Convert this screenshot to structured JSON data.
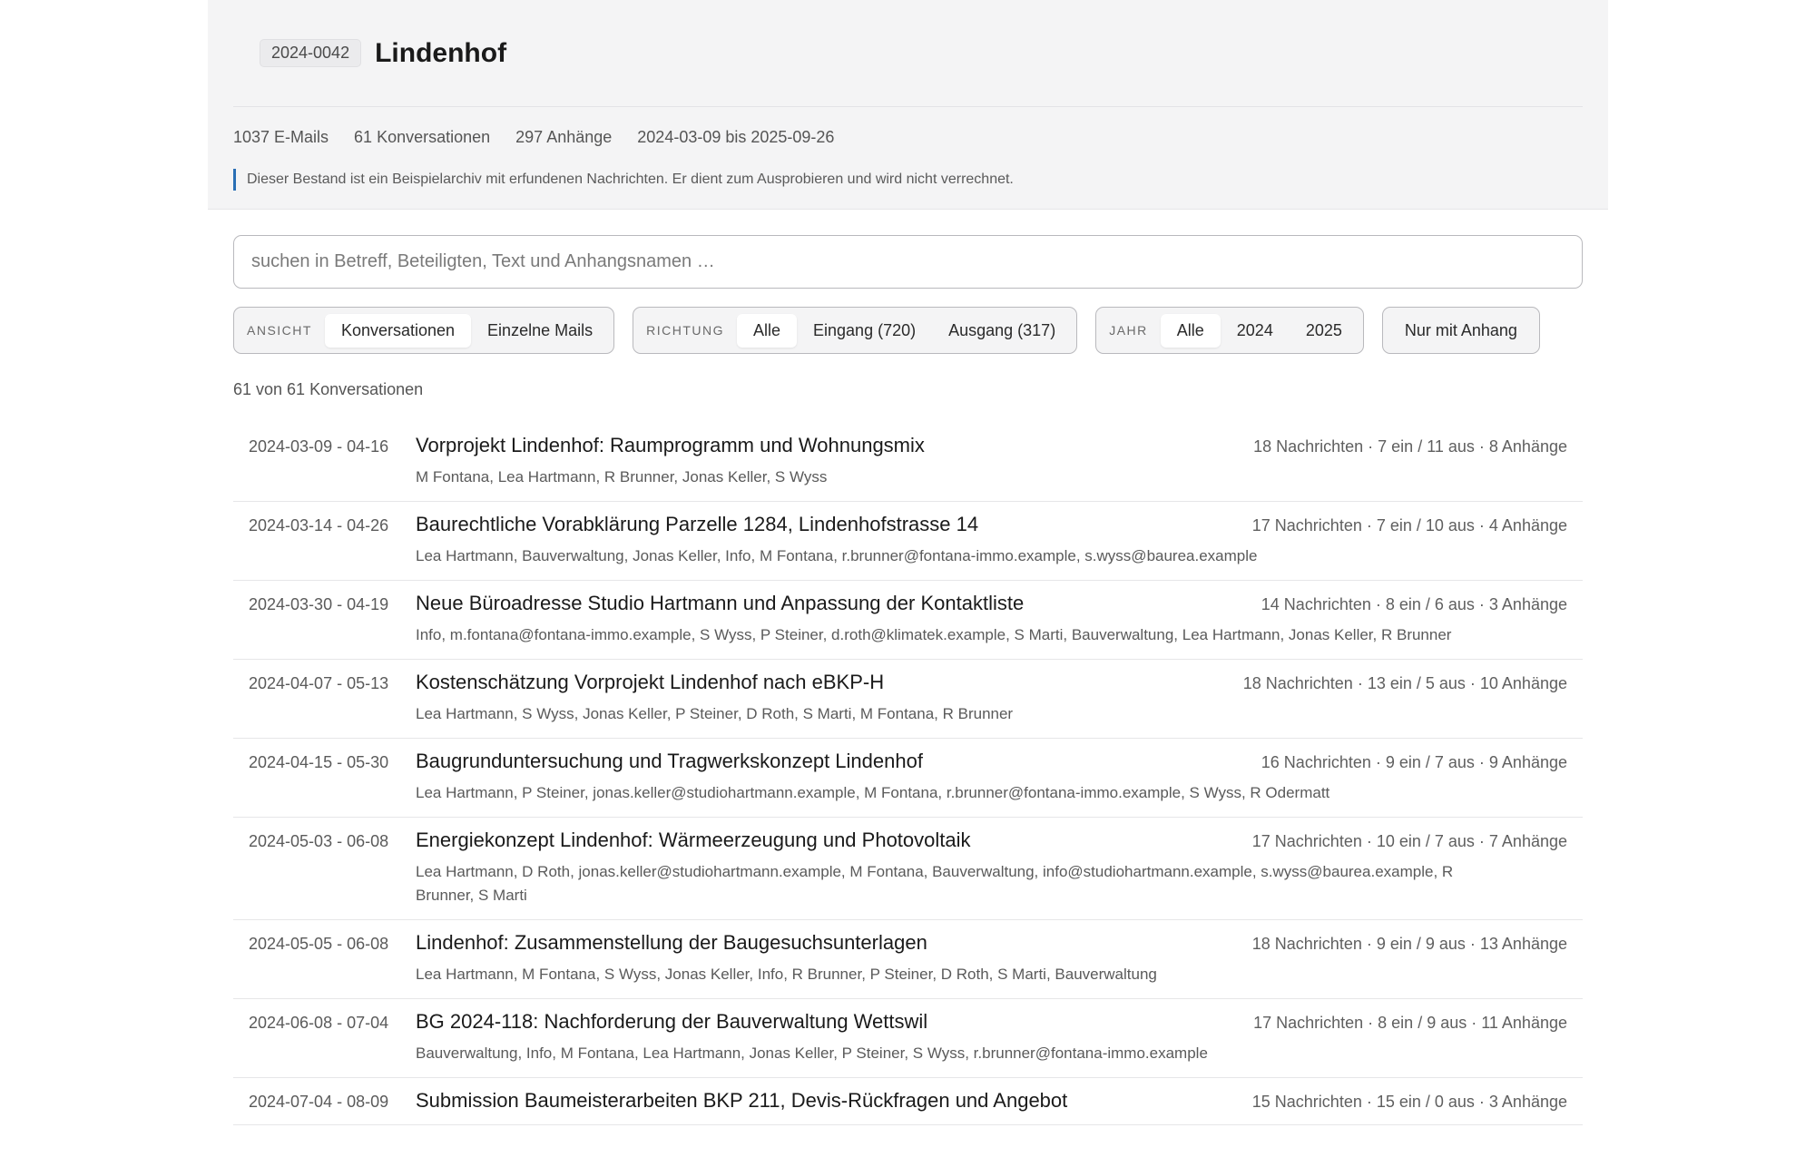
{
  "header": {
    "case_number": "2024-0042",
    "title": "Lindenhof",
    "stats": [
      "1037 E-Mails",
      "61 Konversationen",
      "297 Anhänge",
      "2024-03-09 bis 2025-09-26"
    ],
    "notice": "Dieser Bestand ist ein Beispielarchiv mit erfundenen Nachrichten. Er dient zum Ausprobieren und wird nicht verrechnet."
  },
  "search": {
    "placeholder": "suchen in Betreff, Beteiligten, Text und Anhangsnamen …"
  },
  "filters": {
    "view": {
      "label": "ANSICHT",
      "options": [
        "Konversationen",
        "Einzelne Mails"
      ],
      "active": 0
    },
    "direction": {
      "label": "RICHTUNG",
      "options": [
        "Alle",
        "Eingang (720)",
        "Ausgang (317)"
      ],
      "active": 0
    },
    "year": {
      "label": "JAHR",
      "options": [
        "Alle",
        "2024",
        "2025"
      ],
      "active": 0
    },
    "attachment_toggle": "Nur mit Anhang"
  },
  "result_count": "61 von 61 Konversationen",
  "conversations": [
    {
      "date": "2024-03-09 - 04-16",
      "subject": "Vorprojekt Lindenhof: Raumprogramm und Wohnungsmix",
      "meta": "18 Nachrichten · 7 ein / 11 aus · 8 Anhänge",
      "people": "M Fontana, Lea Hartmann, R Brunner, Jonas Keller, S Wyss"
    },
    {
      "date": "2024-03-14 - 04-26",
      "subject": "Baurechtliche Vorabklärung Parzelle 1284, Lindenhofstrasse 14",
      "meta": "17 Nachrichten · 7 ein / 10 aus · 4 Anhänge",
      "people": "Lea Hartmann, Bauverwaltung, Jonas Keller, Info, M Fontana, r.brunner@fontana-immo.example, s.wyss@baurea.example"
    },
    {
      "date": "2024-03-30 - 04-19",
      "subject": "Neue Büroadresse Studio Hartmann und Anpassung der Kontaktliste",
      "meta": "14 Nachrichten · 8 ein / 6 aus · 3 Anhänge",
      "people": "Info, m.fontana@fontana-immo.example, S Wyss, P Steiner, d.roth@klimatek.example, S Marti, Bauverwaltung, Lea Hartmann, Jonas Keller, R Brunner"
    },
    {
      "date": "2024-04-07 - 05-13",
      "subject": "Kostenschätzung Vorprojekt Lindenhof nach eBKP-H",
      "meta": "18 Nachrichten · 13 ein / 5 aus · 10 Anhänge",
      "people": "Lea Hartmann, S Wyss, Jonas Keller, P Steiner, D Roth, S Marti, M Fontana, R Brunner"
    },
    {
      "date": "2024-04-15 - 05-30",
      "subject": "Baugrunduntersuchung und Tragwerkskonzept Lindenhof",
      "meta": "16 Nachrichten · 9 ein / 7 aus · 9 Anhänge",
      "people": "Lea Hartmann, P Steiner, jonas.keller@studiohartmann.example, M Fontana, r.brunner@fontana-immo.example, S Wyss, R Odermatt"
    },
    {
      "date": "2024-05-03 - 06-08",
      "subject": "Energiekonzept Lindenhof: Wärmeerzeugung und Photovoltaik",
      "meta": "17 Nachrichten · 10 ein / 7 aus · 7 Anhänge",
      "people": "Lea Hartmann, D Roth, jonas.keller@studiohartmann.example, M Fontana, Bauverwaltung, info@studiohartmann.example, s.wyss@baurea.example, R Brunner, S Marti"
    },
    {
      "date": "2024-05-05 - 06-08",
      "subject": "Lindenhof: Zusammenstellung der Baugesuchsunterlagen",
      "meta": "18 Nachrichten · 9 ein / 9 aus · 13 Anhänge",
      "people": "Lea Hartmann, M Fontana, S Wyss, Jonas Keller, Info, R Brunner, P Steiner, D Roth, S Marti, Bauverwaltung"
    },
    {
      "date": "2024-06-08 - 07-04",
      "subject": "BG 2024-118: Nachforderung der Bauverwaltung Wettswil",
      "meta": "17 Nachrichten · 8 ein / 9 aus · 11 Anhänge",
      "people": "Bauverwaltung, Info, M Fontana, Lea Hartmann, Jonas Keller, P Steiner, S Wyss, r.brunner@fontana-immo.example"
    },
    {
      "date": "2024-07-04 - 08-09",
      "subject": "Submission Baumeisterarbeiten BKP 211, Devis-Rückfragen und Angebot",
      "meta": "15 Nachrichten · 15 ein / 0 aus · 3 Anhänge",
      "people": ""
    }
  ]
}
